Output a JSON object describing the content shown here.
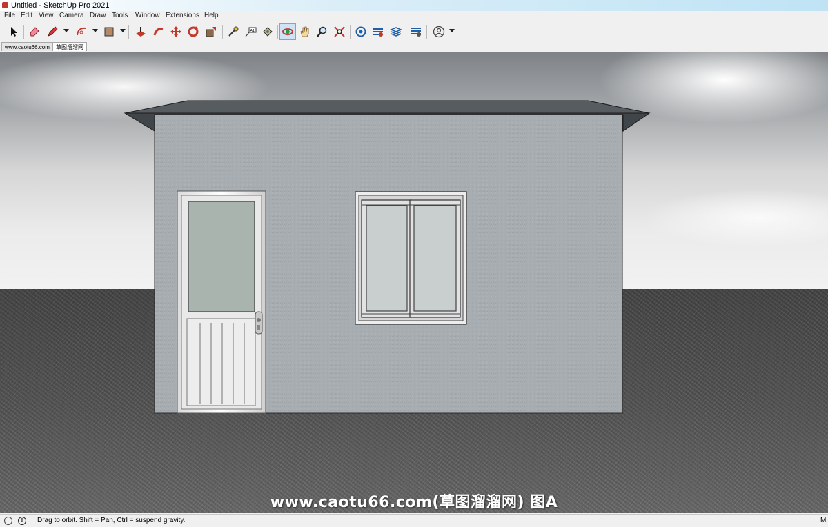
{
  "window": {
    "title": "Untitled - SketchUp Pro 2021"
  },
  "menu": [
    "File",
    "Edit",
    "View",
    "Camera",
    "Draw",
    "Tools",
    "Window",
    "Extensions",
    "Help"
  ],
  "toolbar": {
    "tools": [
      "select-tool",
      "eraser-tool",
      "line-tool",
      "arc-tool",
      "rectangle-tool",
      "push-pull-tool",
      "follow-me-tool",
      "move-tool",
      "rotate-tool",
      "scale-tool",
      "tape-measure-tool",
      "text-tool",
      "paint-bucket-tool",
      "orbit-tool",
      "pan-tool",
      "zoom-tool",
      "zoom-extents-tool",
      "3d-warehouse-tool",
      "extension-warehouse-tool",
      "layout-tool",
      "extension-manager-tool",
      "account-tool"
    ],
    "active": "orbit-tool"
  },
  "tabs": [
    "www.caotu66.com",
    "草图溜溜网"
  ],
  "viewport": {
    "watermark": "www.caotu66.com(草图溜溜网) 图A"
  },
  "status": {
    "text": "Drag to orbit. Shift = Pan, Ctrl = suspend gravity.",
    "right": "M"
  },
  "colors": {
    "accent": "#cfe2f6",
    "wall": "#a7acb0",
    "roof": "#515658"
  }
}
